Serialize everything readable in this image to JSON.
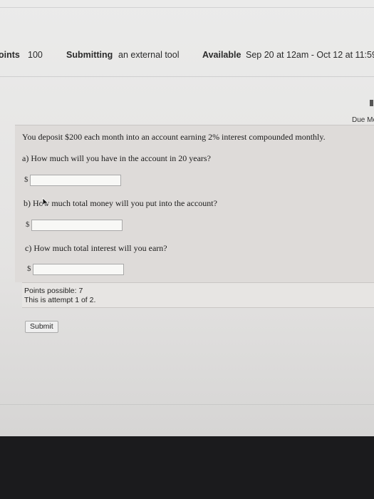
{
  "assignment_meta": {
    "points_label": "oints",
    "points_value": "100",
    "submitting_label": "Submitting",
    "submitting_value": "an external tool",
    "available_label": "Available",
    "available_value": "Sep 20 at 12am - Oct 12 at 11:59"
  },
  "due_label": "Due Mo",
  "question": {
    "prompt": "You deposit $200 each month into an account earning 2% interest compounded monthly.",
    "parts": [
      {
        "text": "a) How much will you have in the account in 20 years?",
        "currency": "$",
        "value": ""
      },
      {
        "text": "b) How much total money will you put into the account?",
        "currency": "$",
        "value": ""
      },
      {
        "text": "c) How much total interest will you earn?",
        "currency": "$",
        "value": ""
      }
    ]
  },
  "points_possible": "Points possible: 7",
  "attempt_text": "This is attempt 1 of 2.",
  "submit_label": "Submit",
  "colors": {
    "question_bg": "#dedbd9",
    "page_bg": "#e6e5e4"
  }
}
